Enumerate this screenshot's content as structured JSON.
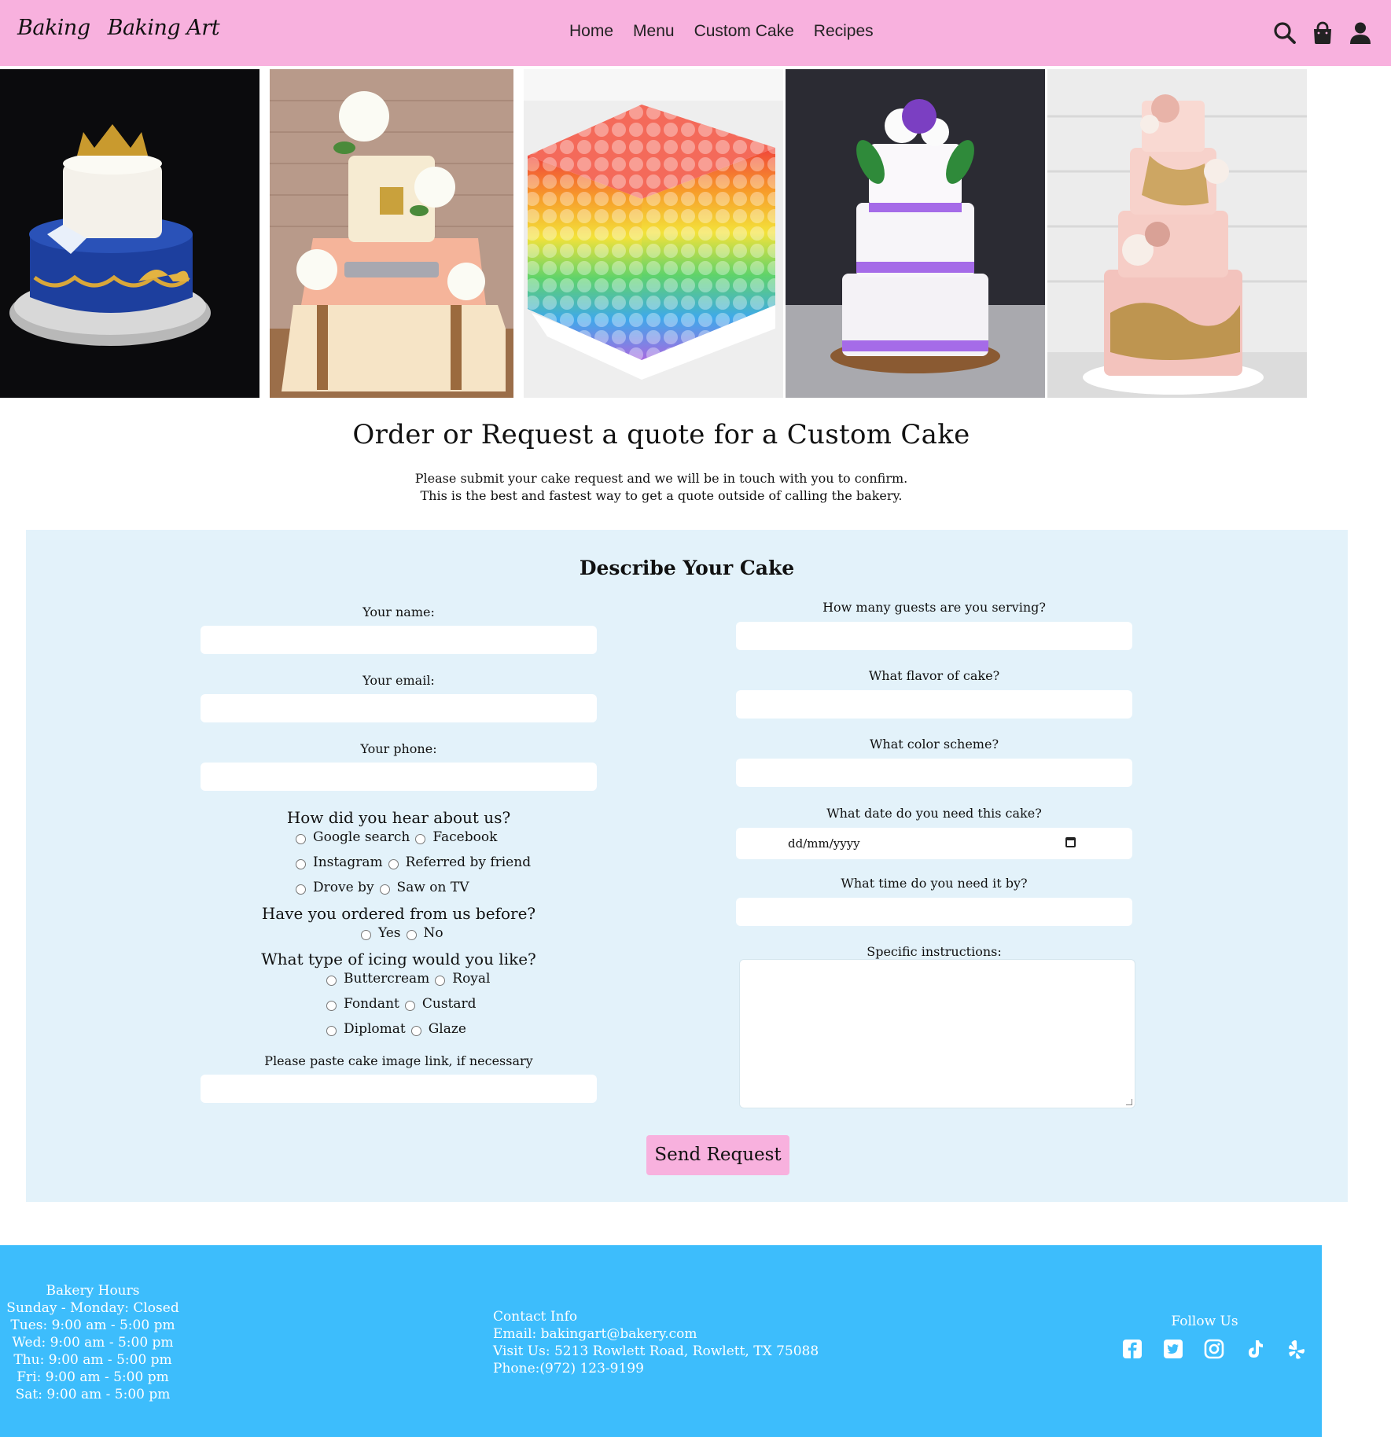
{
  "nav": {
    "logo_part1": "Baking",
    "logo_part2": "Baking Art",
    "links": [
      "Home",
      "Menu",
      "Custom Cake",
      "Recipes"
    ],
    "icons": [
      "search-icon",
      "shopping-bag-icon",
      "user-icon"
    ],
    "background_color": "#f8b1de"
  },
  "gallery": {
    "images": [
      "royal-blue-crown-cake",
      "stacked-suitcase-cake",
      "rainbow-bubble-cube-cake",
      "purple-dragonfly-wedding-cake",
      "pink-gold-floral-tier-cake"
    ]
  },
  "intro": {
    "title": "Order or Request a quote for a Custom Cake",
    "line1": "Please submit your cake request and we will be in touch with you to confirm.",
    "line2": "This is the best and fastest way to get a quote outside of calling the bakery."
  },
  "form": {
    "title": "Describe Your Cake",
    "name_label": "Your name:",
    "email_label": "Your email:",
    "phone_label": "Your phone:",
    "hear_question": "How did you hear about us?",
    "hear_options": [
      "Google search",
      "Facebook",
      "Instagram",
      "Referred by friend",
      "Drove by",
      "Saw on TV"
    ],
    "ordered_question": "Have you ordered from us before?",
    "ordered_options": [
      "Yes",
      "No"
    ],
    "icing_question": "What type of icing would you like?",
    "icing_options": [
      "Buttercream",
      "Royal",
      "Fondant",
      "Custard",
      "Diplomat",
      "Glaze"
    ],
    "image_link_label": "Please paste cake image link, if necessary",
    "guests_label": "How many guests are you serving?",
    "flavor_label": "What flavor of cake?",
    "color_label": "What color scheme?",
    "date_label": "What date do you need this cake?",
    "date_placeholder": "dd/mm/yyyy",
    "time_label": "What time do you need it by?",
    "instructions_label": "Specific instructions:",
    "submit_label": "Send Request",
    "panel_color": "#e3f2fa",
    "button_color": "#f8b1de"
  },
  "footer": {
    "hours_title": "Bakery Hours",
    "hours": [
      "Sunday - Monday: Closed",
      "Tues: 9:00 am - 5:00 pm",
      "Wed: 9:00 am - 5:00 pm",
      "Thu: 9:00 am - 5:00 pm",
      "Fri: 9:00 am - 5:00 pm",
      "Sat: 9:00 am - 5:00 pm"
    ],
    "contact_title": "Contact Info",
    "email": "Email: bakingart@bakery.com",
    "address": "Visit Us: 5213 Rowlett Road, Rowlett, TX 75088",
    "phone": "Phone:(972) 123-9199",
    "follow_title": "Follow Us",
    "social_icons": [
      "facebook-icon",
      "twitter-icon",
      "instagram-icon",
      "tiktok-icon",
      "yelp-icon"
    ],
    "background_color": "#3dbdfc"
  }
}
